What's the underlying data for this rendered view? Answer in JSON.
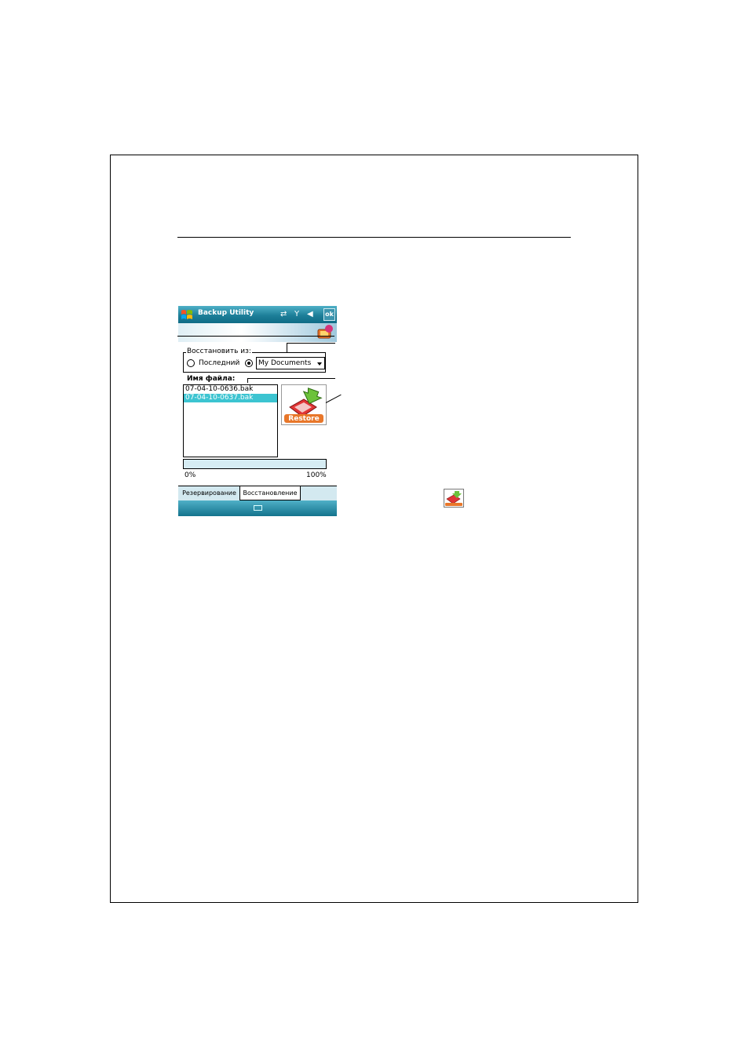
{
  "window": {
    "title": "Backup Utility",
    "ok_label": "ok"
  },
  "restore_from": {
    "label": "Восстановить из:",
    "options": [
      {
        "label": "Последний",
        "selected": false
      },
      {
        "label": "",
        "selected": true
      }
    ],
    "location_value": "My Documents"
  },
  "files": {
    "label": "Имя файла:",
    "items": [
      {
        "name": "07-04-10-0636.bak",
        "selected": false
      },
      {
        "name": "07-04-10-0637.bak",
        "selected": true
      }
    ]
  },
  "restore_button": {
    "icon": "restore-icon",
    "label": "Restore"
  },
  "progress": {
    "min_label": "0%",
    "max_label": "100%",
    "value": 0
  },
  "tabs": [
    {
      "label": "Резервирование",
      "active": false
    },
    {
      "label": "Восстановление",
      "active": true
    }
  ],
  "colors": {
    "title_bar": "#1d7f99",
    "selection": "#3cc4d1",
    "restore_badge": "#e8772a"
  }
}
